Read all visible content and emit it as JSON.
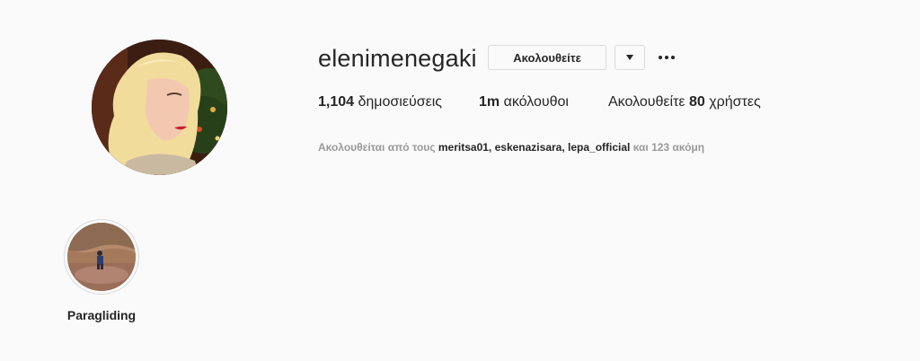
{
  "profile": {
    "username": "elenimenegaki",
    "avatar_icon": "profile-photo",
    "follow_label": "Ακολουθείτε",
    "dropdown_icon": "triangle-down-icon",
    "more_icon": "ellipsis-icon"
  },
  "stats": {
    "posts_count": "1,104",
    "posts_label": "δημοσιεύσεις",
    "followers_count": "1m",
    "followers_label": "ακόλουθοι",
    "following_prefix": "Ακολουθείτε",
    "following_count": "80",
    "following_suffix": "χρήστες"
  },
  "followed_by": {
    "prefix": "Ακολουθείται από τους",
    "users": [
      "meritsa01",
      "eskenazisara",
      "lepa_official"
    ],
    "suffix": "και 123 ακόμη"
  },
  "highlights": [
    {
      "label": "Paragliding"
    }
  ]
}
